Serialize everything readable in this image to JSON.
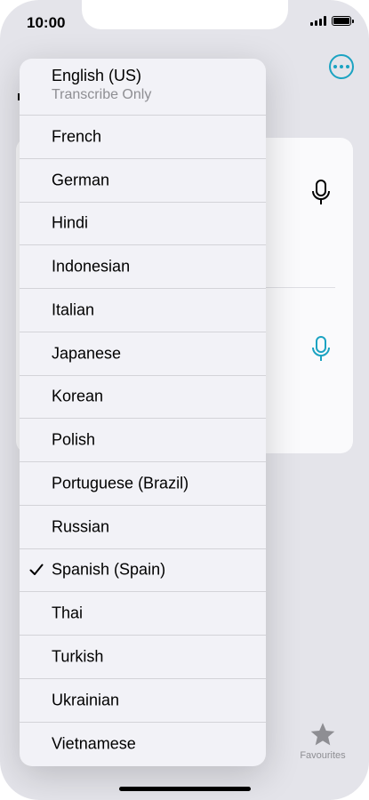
{
  "status": {
    "time": "10:00"
  },
  "icons": {
    "more": "ellipsis-circle-icon",
    "mic": "microphone-icon",
    "check": "checkmark-icon",
    "favourites": "star-icon"
  },
  "colors": {
    "accent": "#1ba3c2",
    "background": "#e4e4ea",
    "menu_background": "#f2f2f7",
    "secondary_text": "#8e8e93"
  },
  "menu": {
    "items": [
      {
        "label": "English (US)",
        "subtitle": "Transcribe Only"
      },
      {
        "label": "French"
      },
      {
        "label": "German"
      },
      {
        "label": "Hindi"
      },
      {
        "label": "Indonesian"
      },
      {
        "label": "Italian"
      },
      {
        "label": "Japanese"
      },
      {
        "label": "Korean"
      },
      {
        "label": "Polish"
      },
      {
        "label": "Portuguese (Brazil)"
      },
      {
        "label": "Russian"
      },
      {
        "label": "Spanish (Spain)",
        "selected": true
      },
      {
        "label": "Thai"
      },
      {
        "label": "Turkish"
      },
      {
        "label": "Ukrainian"
      },
      {
        "label": "Vietnamese"
      }
    ]
  },
  "tabbar": {
    "favourites_label": "Favourites"
  }
}
